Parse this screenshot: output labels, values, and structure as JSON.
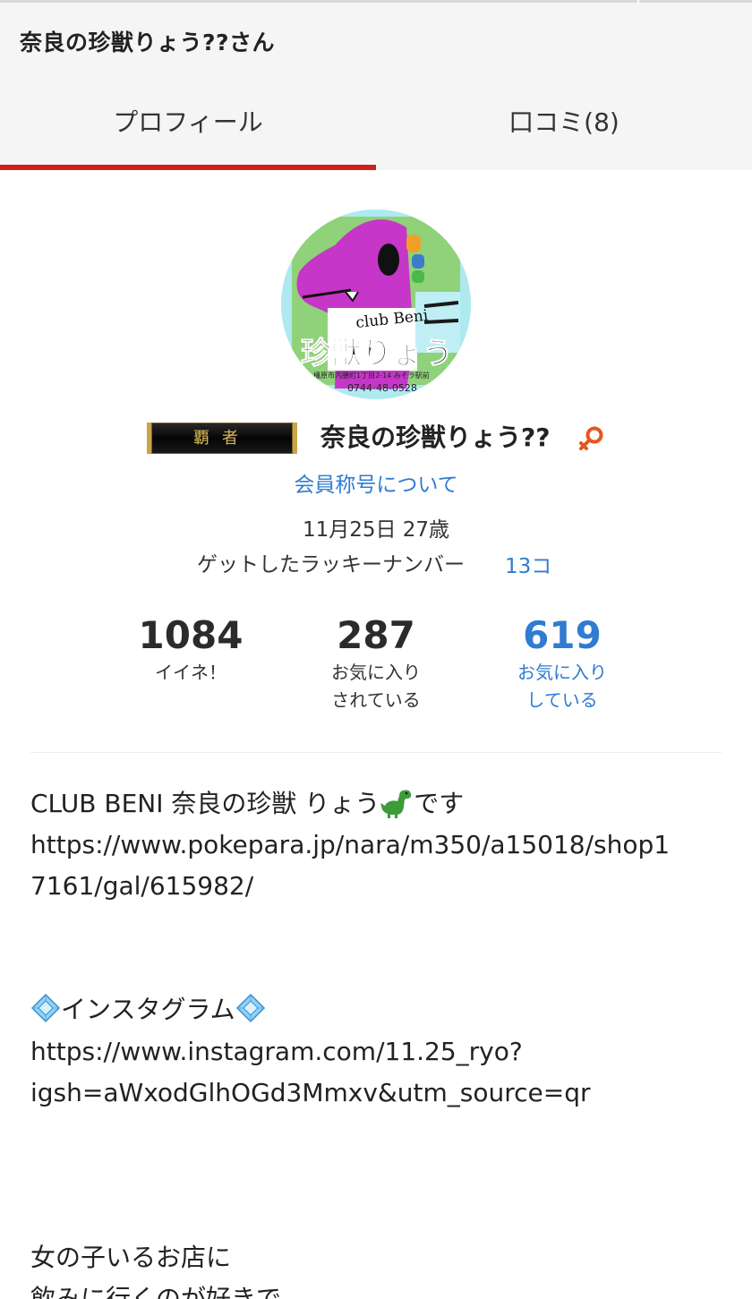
{
  "header": {
    "title": "奈良の珍獣りょう??さん"
  },
  "tabs": [
    {
      "label": "プロフィール",
      "active": true
    },
    {
      "label": "口コミ(8)",
      "active": false
    }
  ],
  "colors": {
    "accent_red": "#d0201c",
    "link_blue": "#2f7cd0",
    "gender_orange": "#e8561e"
  },
  "profile": {
    "avatar": {
      "name_text": "珍獣りょう",
      "club_text": "club Beni",
      "address_text": "橿原市内膳町1丁目2-14 みそラ駅前",
      "phone_text": "0744-48-0528"
    },
    "rank_badge": "覇者",
    "name": "奈良の珍獣りょう??",
    "gender_icon": "female-icon",
    "member_title_link": "会員称号について",
    "birthday": "11月25日 27歳",
    "lucky_number_label": "ゲットしたラッキーナンバー",
    "lucky_number_count": "13コ"
  },
  "stats": [
    {
      "value": "1084",
      "label_line1": "イイネ！",
      "label_line2": ""
    },
    {
      "value": "287",
      "label_line1": "お気に入り",
      "label_line2": "されている"
    },
    {
      "value": "619",
      "label_line1": "お気に入り",
      "label_line2": "している"
    }
  ],
  "bio": {
    "line1": "CLUB BENI 奈良の珍獣 りょう",
    "line1_suffix": "です",
    "shop_url_line1": "https://www.pokepara.jp/nara/m350/a15018/shop1",
    "shop_url_line2": "7161/gal/615982/",
    "instagram_heading": "インスタグラム",
    "instagram_url_line1": "https://www.instagram.com/11.25_ryo?",
    "instagram_url_line2": "igsh=aWxodGlhOGd3Mmxv&utm_source=qr",
    "line_last1": "女の子いるお店に",
    "line_last2": "飲みに行くのが好きで"
  }
}
